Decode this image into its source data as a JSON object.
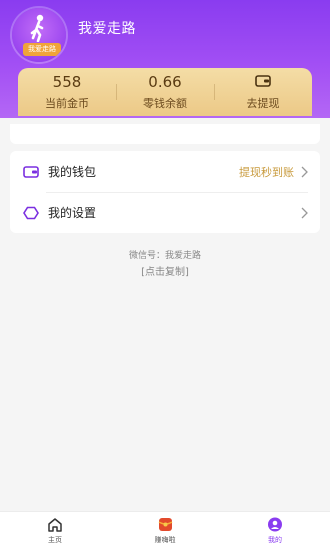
{
  "header": {
    "username": "我爱走路",
    "avatar_badge": "我爱走路"
  },
  "stats": [
    {
      "value": "558",
      "label": "当前金币"
    },
    {
      "value": "0.66",
      "label": "零钱余额"
    },
    {
      "value": "",
      "label": "去提现",
      "icon": "wallet-icon"
    }
  ],
  "menu": {
    "wallet": {
      "label": "我的钱包",
      "extra": "提现秒到账",
      "icon": "wallet-icon"
    },
    "settings": {
      "label": "我的设置",
      "icon": "settings-icon"
    }
  },
  "wechat_text": "微信号：我爱走路",
  "copy_text": "[点击复制]",
  "tabs": [
    {
      "label": "主页",
      "icon": "home-icon"
    },
    {
      "label": "赚嗨啦",
      "icon": "red-envelope-icon"
    },
    {
      "label": "我的",
      "icon": "profile-icon"
    }
  ],
  "colors": {
    "header_purple": "#8a3cf0",
    "gold_card": "#ecc987",
    "accent_gold_text": "#c89a3c"
  }
}
